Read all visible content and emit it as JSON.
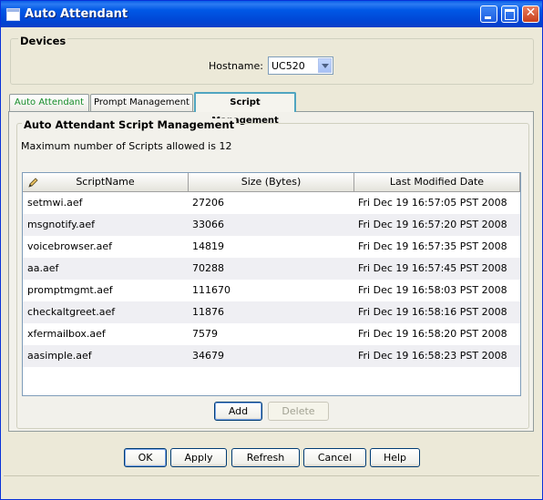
{
  "window": {
    "title": "Auto Attendant"
  },
  "devices": {
    "group_title": "Devices",
    "hostname_label": "Hostname:",
    "hostname_value": "UC520"
  },
  "tabs": [
    {
      "label": "Auto Attendant"
    },
    {
      "label": "Prompt Management"
    },
    {
      "label": "Script Management",
      "active": true
    }
  ],
  "script_management": {
    "group_title": "Auto Attendant Script Management",
    "max_text": "Maximum number of Scripts allowed is 12",
    "columns": [
      "ScriptName",
      "Size (Bytes)",
      "Last Modified Date"
    ],
    "rows": [
      [
        "setmwi.aef",
        "27206",
        "Fri Dec 19 16:57:05 PST 2008"
      ],
      [
        "msgnotify.aef",
        "33066",
        "Fri Dec 19 16:57:20 PST 2008"
      ],
      [
        "voicebrowser.aef",
        "14819",
        "Fri Dec 19 16:57:35 PST 2008"
      ],
      [
        "aa.aef",
        "70288",
        "Fri Dec 19 16:57:45 PST 2008"
      ],
      [
        "promptmgmt.aef",
        "111670",
        "Fri Dec 19 16:58:03 PST 2008"
      ],
      [
        "checkaltgreet.aef",
        "11876",
        "Fri Dec 19 16:58:16 PST 2008"
      ],
      [
        "xfermailbox.aef",
        "7579",
        "Fri Dec 19 16:58:20 PST 2008"
      ],
      [
        "aasimple.aef",
        "34679",
        "Fri Dec 19 16:58:23 PST 2008"
      ]
    ],
    "add_label": "Add",
    "delete_label": "Delete"
  },
  "footer": {
    "ok_label": "OK",
    "apply_label": "Apply",
    "refresh_label": "Refresh",
    "cancel_label": "Cancel",
    "help_label": "Help"
  },
  "colors": {
    "titlebar": "#0058E6",
    "active_tab_border": "#50A5C0",
    "inactive_tab_text_green": "#178D2B"
  }
}
